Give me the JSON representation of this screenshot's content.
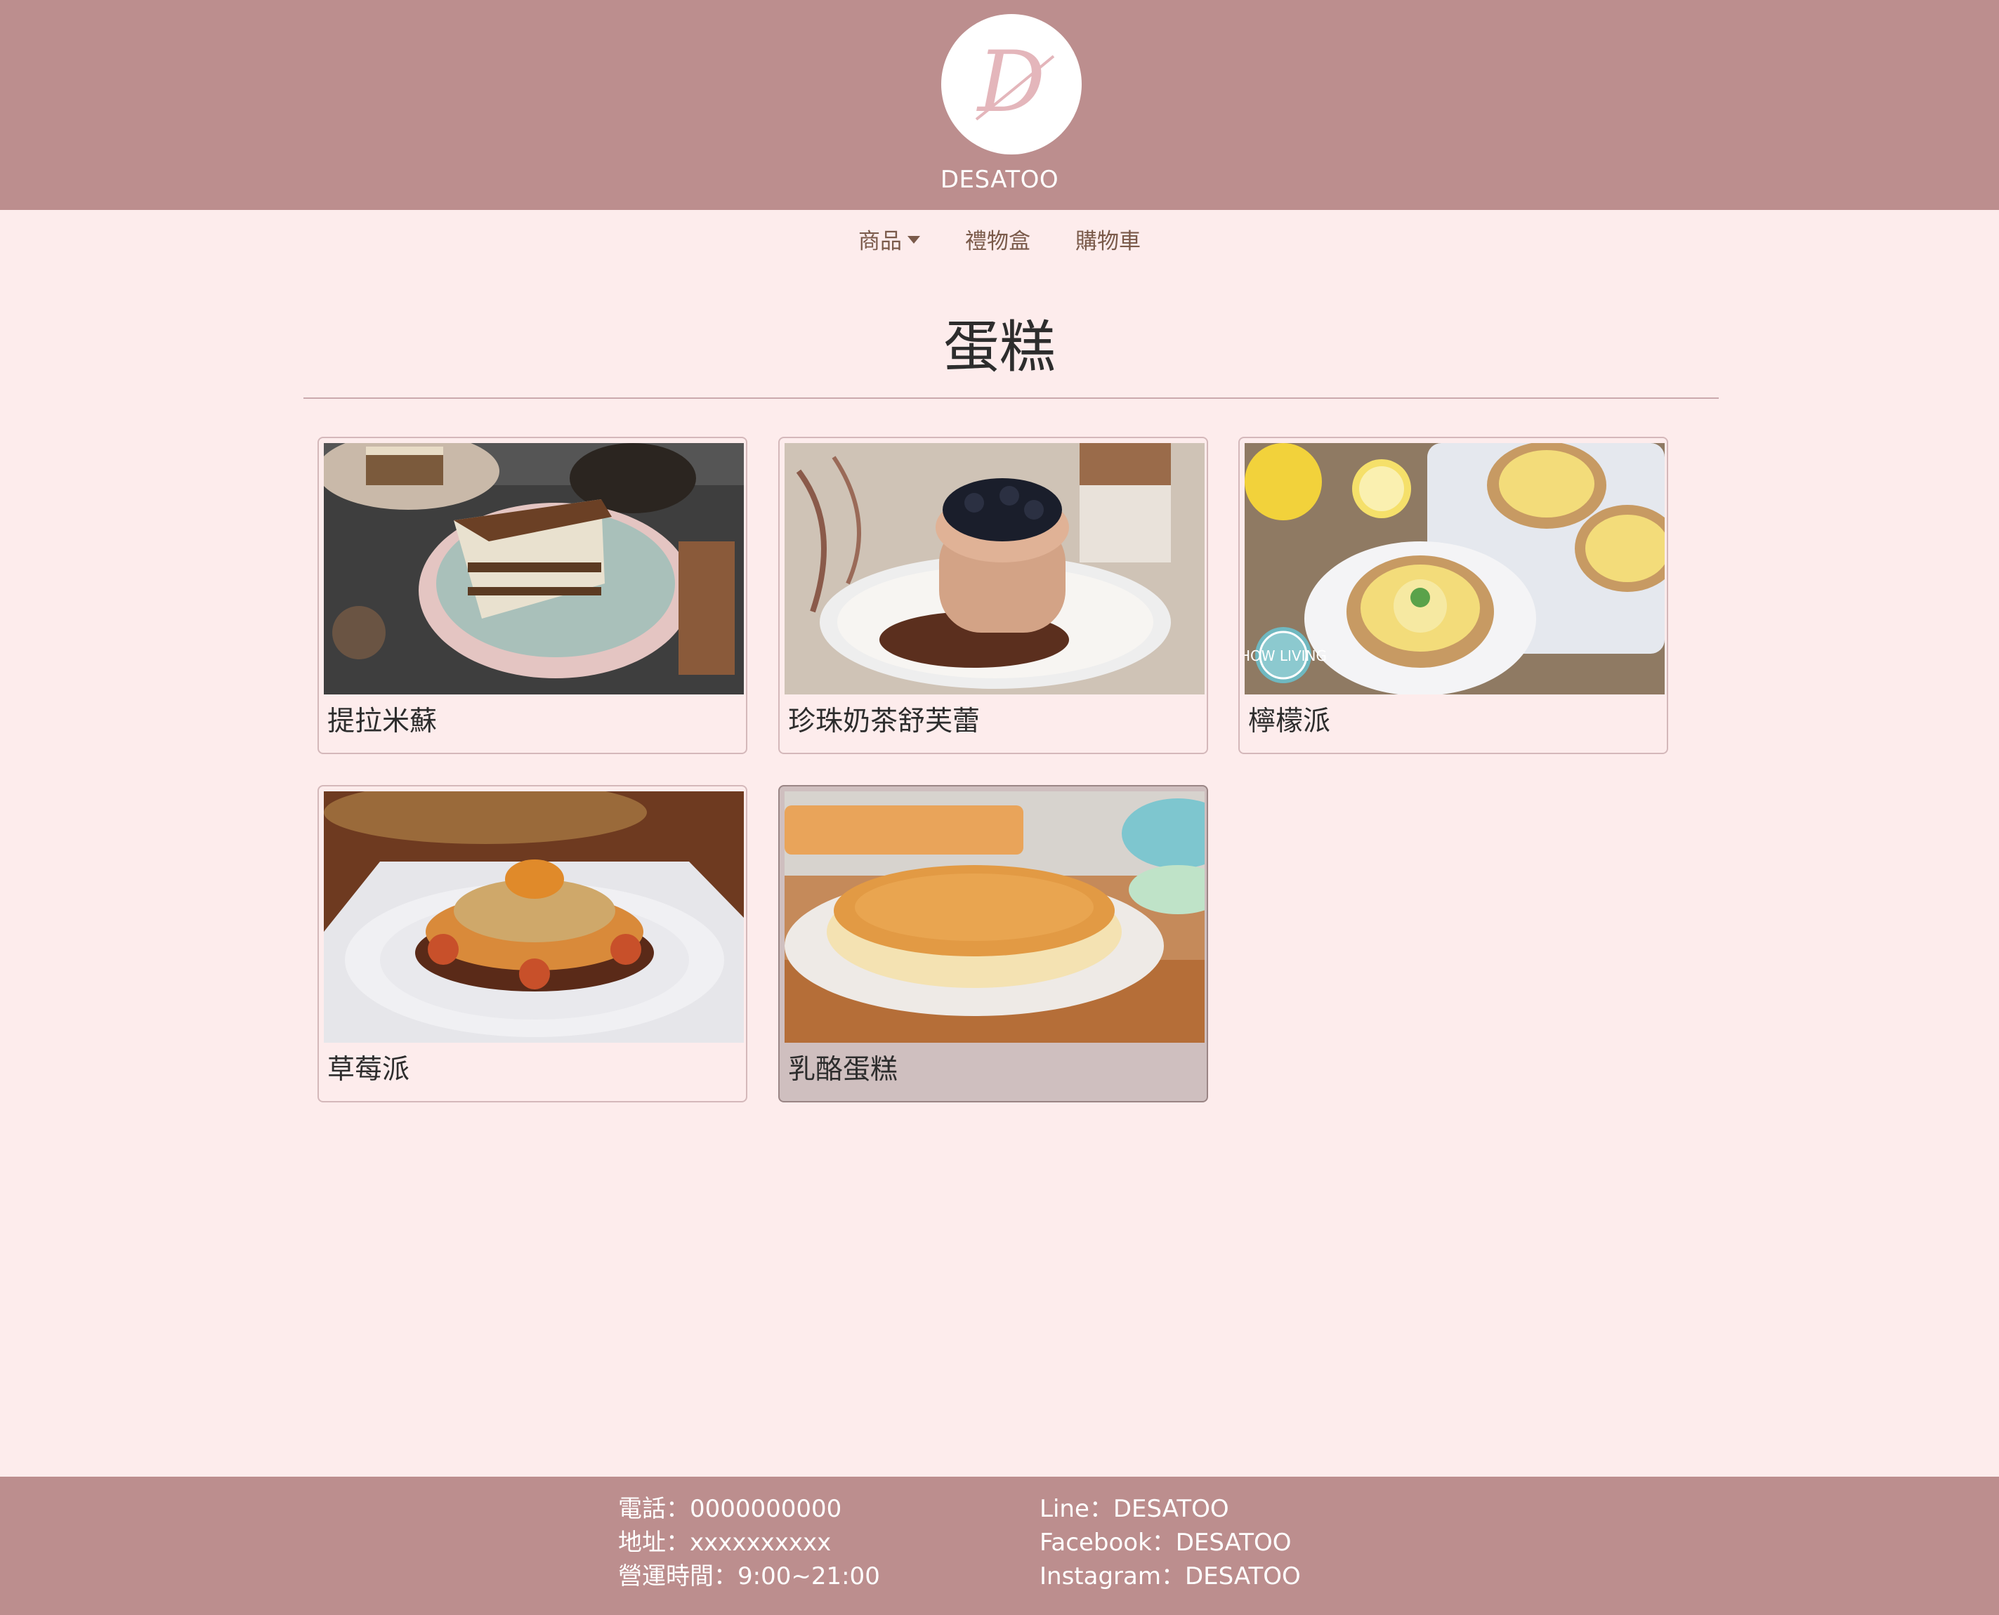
{
  "header": {
    "brand": "DESATOO",
    "logo_letter": "D"
  },
  "nav": [
    {
      "label": "商品",
      "has_dropdown": true
    },
    {
      "label": "禮物盒",
      "has_dropdown": false
    },
    {
      "label": "購物車",
      "has_dropdown": false
    }
  ],
  "page": {
    "title": "蛋糕"
  },
  "products": [
    {
      "name": "提拉米蘇",
      "icon": "tiramisu-image"
    },
    {
      "name": "珍珠奶茶舒芙蕾",
      "icon": "boba-souffle-image"
    },
    {
      "name": "檸檬派",
      "icon": "lemon-tart-image",
      "watermark": "HOW LIVING"
    },
    {
      "name": "草莓派",
      "icon": "strawberry-pie-image"
    },
    {
      "name": "乳酪蛋糕",
      "icon": "cheesecake-image"
    }
  ],
  "footer": {
    "left": [
      "電話：0000000000",
      "地址：xxxxxxxxxx",
      "營運時間：9:00~21:00"
    ],
    "right": [
      "Line：DESATOO",
      "Facebook：DESATOO",
      "Instagram：DESATOO"
    ]
  },
  "colors": {
    "header": "#bc8e8e",
    "background": "#fdecec",
    "nav_text": "#7a5a4a"
  }
}
